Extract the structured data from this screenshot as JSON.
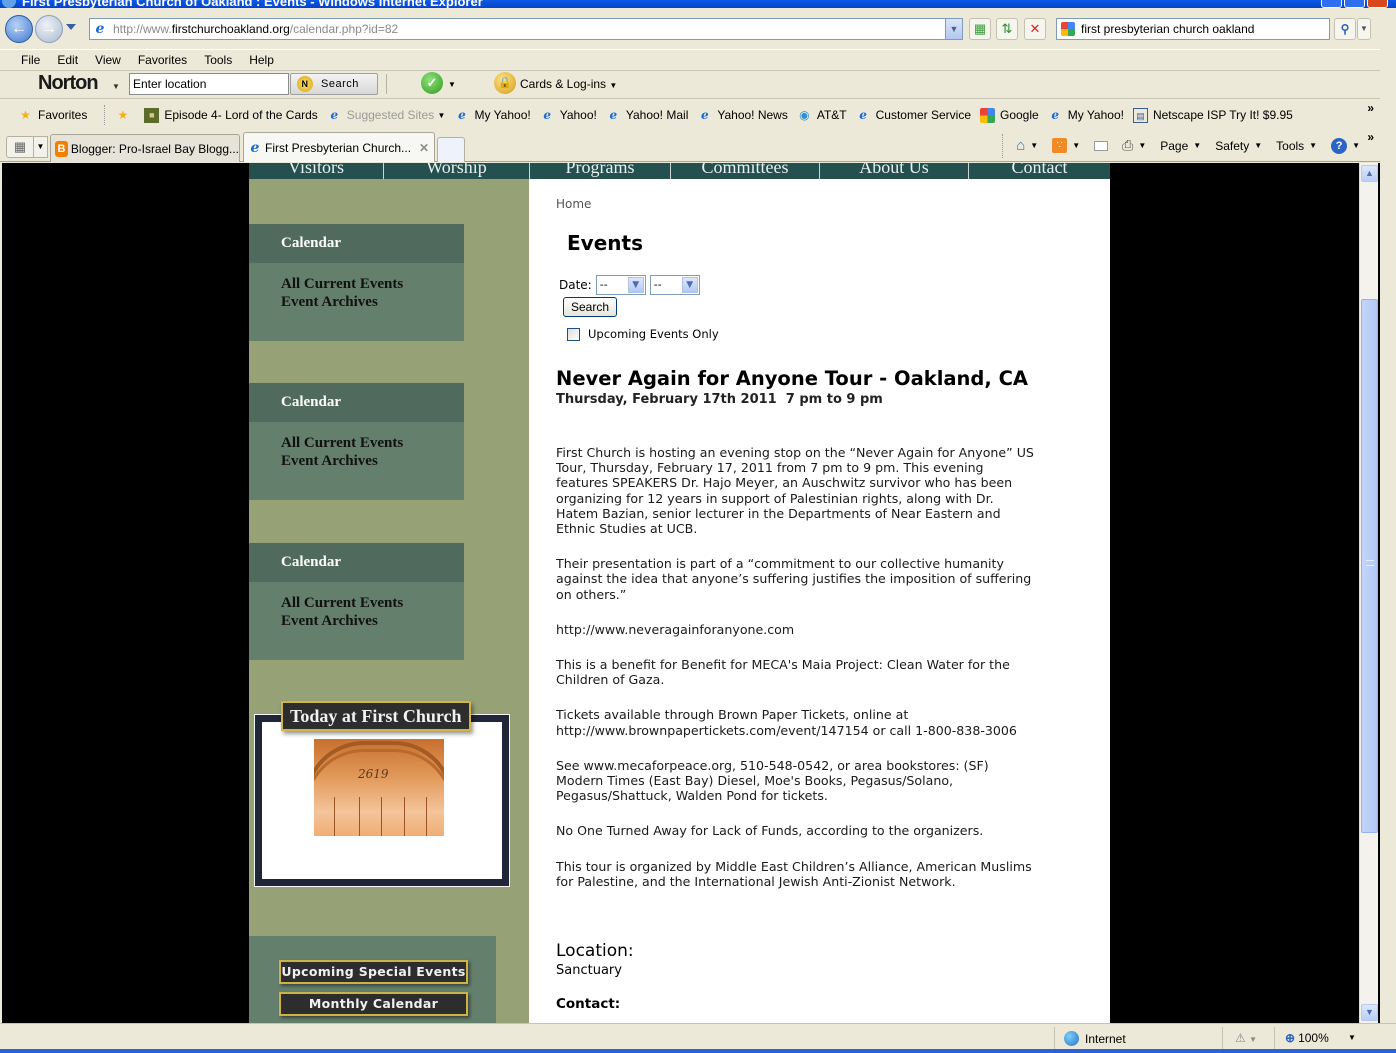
{
  "window": {
    "title": "First Presbyterian Church of Oakland : Events - Windows Internet Explorer"
  },
  "address_bar": {
    "url_prefix": "http://www.",
    "url_domain": "firstchurchoakland.org",
    "url_path": "/calendar.php?id=82"
  },
  "search_bar": {
    "query": "first presbyterian church oakland"
  },
  "menu": [
    "File",
    "Edit",
    "View",
    "Favorites",
    "Tools",
    "Help"
  ],
  "norton": {
    "logo": "Norton",
    "location_placeholder": "Enter location",
    "search_label": "Search",
    "cards_label": "Cards & Log-ins"
  },
  "favorites_bar": {
    "favorites_label": "Favorites",
    "items": [
      "Episode 4- Lord of the Cards",
      "Suggested Sites",
      "My Yahoo!",
      "Yahoo!",
      "Yahoo! Mail",
      "Yahoo! News",
      "AT&T",
      "Customer Service",
      "Google",
      "My Yahoo!",
      "Netscape ISP Try It! $9.95"
    ]
  },
  "tabs": [
    {
      "label": "Blogger: Pro-Israel Bay Blogg...",
      "active": false
    },
    {
      "label": "First Presbyterian Church...",
      "active": true
    }
  ],
  "command_bar": {
    "page": "Page",
    "safety": "Safety",
    "tools": "Tools"
  },
  "site": {
    "nav": [
      "Visitors",
      "Worship",
      "Programs",
      "Committees",
      "About Us",
      "Contact"
    ],
    "sidebar_boxes": [
      {
        "heading": "Calendar",
        "links": [
          "All Current Events",
          "Event Archives"
        ]
      },
      {
        "heading": "Calendar",
        "links": [
          "All Current Events",
          "Event Archives"
        ]
      },
      {
        "heading": "Calendar",
        "links": [
          "All Current Events",
          "Event Archives"
        ]
      }
    ],
    "today_title": "Today at First Church",
    "photo_number": "2619",
    "buttons": [
      "Upcoming Special Events",
      "Monthly Calendar"
    ]
  },
  "main": {
    "breadcrumb": "Home",
    "page_title": "Events",
    "filter": {
      "date_label": "Date:",
      "month_value": "--",
      "year_value": "--",
      "search_label": "Search",
      "upcoming_label": "Upcoming Events Only",
      "upcoming_checked": false
    },
    "event": {
      "title": "Never Again for Anyone Tour - Oakland, CA",
      "date": "Thursday, February 17th 2011  7 pm to 9 pm",
      "paragraphs": [
        "First Church is hosting an evening stop on the “Never Again for Anyone” US Tour, Thursday, February 17, 2011 from 7 pm to 9 pm. This evening features SPEAKERS Dr. Hajo Meyer, an Auschwitz survivor who has been organizing for 12 years in support of Palestinian rights, along with Dr. Hatem Bazian, senior lecturer in the Departments of Near Eastern and Ethnic Studies at UCB.",
        "Their presentation is part of a “commitment to our collective humanity against the idea that anyone’s suffering justifies the imposition of suffering on others.”",
        "http://www.neveragainforanyone.com",
        "This is a benefit for Benefit for MECA's Maia Project: Clean Water for the Children of Gaza.",
        "Tickets available through Brown Paper Tickets, online at http://www.brownpapertickets.com/event/147154 or call 1-800-838-3006",
        "See www.mecaforpeace.org, 510-548-0542, or area bookstores: (SF) Modern Times (East Bay) Diesel, Moe's Books, Pegasus/Solano, Pegasus/Shattuck, Walden Pond for tickets.",
        "No One Turned Away for Lack of Funds, according to the organizers.",
        "This tour is organized by Middle East Children’s Alliance, American Muslims for Palestine, and the International Jewish Anti-Zionist Network."
      ],
      "location_heading": "Location:",
      "location": "Sanctuary",
      "contact_heading": "Contact:"
    }
  },
  "status_bar": {
    "zone": "Internet",
    "zoom": "100%"
  }
}
